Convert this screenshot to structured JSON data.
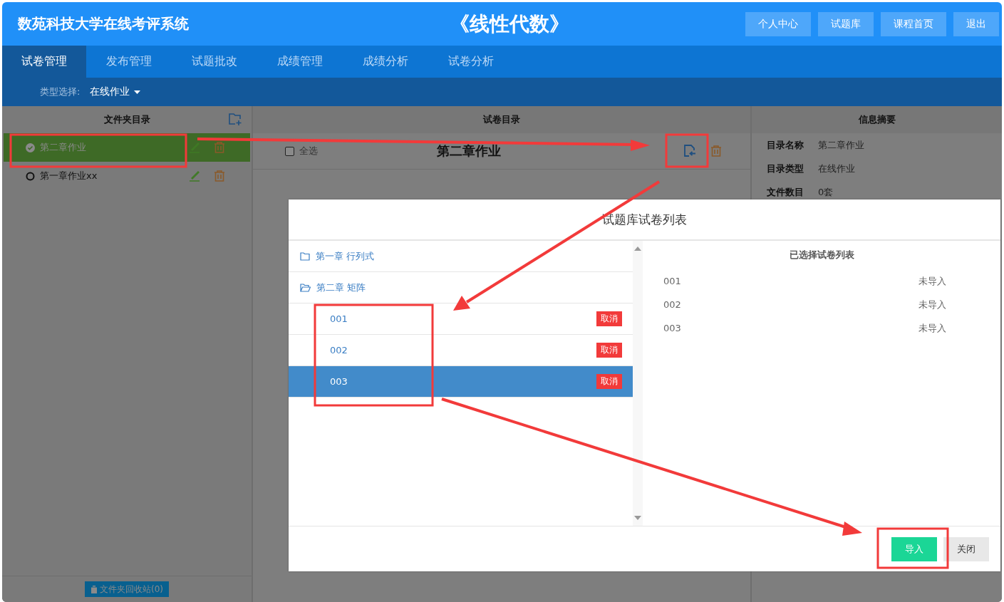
{
  "header": {
    "title": "数苑科技大学在线考评系统",
    "course": "《线性代数》",
    "buttons": [
      "个人中心",
      "试题库",
      "课程首页",
      "退出"
    ]
  },
  "tabs": [
    {
      "label": "试卷管理",
      "selected": true
    },
    {
      "label": "发布管理",
      "selected": false
    },
    {
      "label": "试题批改",
      "selected": false
    },
    {
      "label": "成绩管理",
      "selected": false
    },
    {
      "label": "成绩分析",
      "selected": false
    },
    {
      "label": "试卷分析",
      "selected": false
    }
  ],
  "type_filter": {
    "label": "类型选择:",
    "value": "在线作业"
  },
  "folder_panel": {
    "title": "文件夹目录",
    "items": [
      {
        "name": "第二章作业",
        "selected": true
      },
      {
        "name": "第一章作业xx",
        "selected": false
      }
    ],
    "recycle_button": "文件夹回收站(0)"
  },
  "paper_panel": {
    "title": "试卷目录",
    "select_all": {
      "label": "全选",
      "checked": false
    },
    "folder_name": "第二章作业"
  },
  "info_panel": {
    "title": "信息摘要",
    "fields": [
      {
        "label": "目录名称",
        "value": "第二章作业"
      },
      {
        "label": "目录类型",
        "value": "在线作业"
      },
      {
        "label": "文件数目",
        "value": "0套"
      }
    ]
  },
  "modal": {
    "title": "试题库试卷列表",
    "tree": [
      {
        "name": "第一章 行列式",
        "expanded": false
      },
      {
        "name": "第二章 矩阵",
        "expanded": true,
        "children": [
          {
            "name": "001",
            "selected": false,
            "action": "取消"
          },
          {
            "name": "002",
            "selected": false,
            "action": "取消"
          },
          {
            "name": "003",
            "selected": true,
            "action": "取消"
          }
        ]
      }
    ],
    "selected_list": {
      "title": "已选择试卷列表",
      "rows": [
        {
          "name": "001",
          "status": "未导入"
        },
        {
          "name": "002",
          "status": "未导入"
        },
        {
          "name": "003",
          "status": "未导入"
        }
      ]
    },
    "buttons": [
      {
        "label": "导入",
        "kind": "primary"
      },
      {
        "label": "关闭",
        "kind": "default"
      }
    ]
  }
}
